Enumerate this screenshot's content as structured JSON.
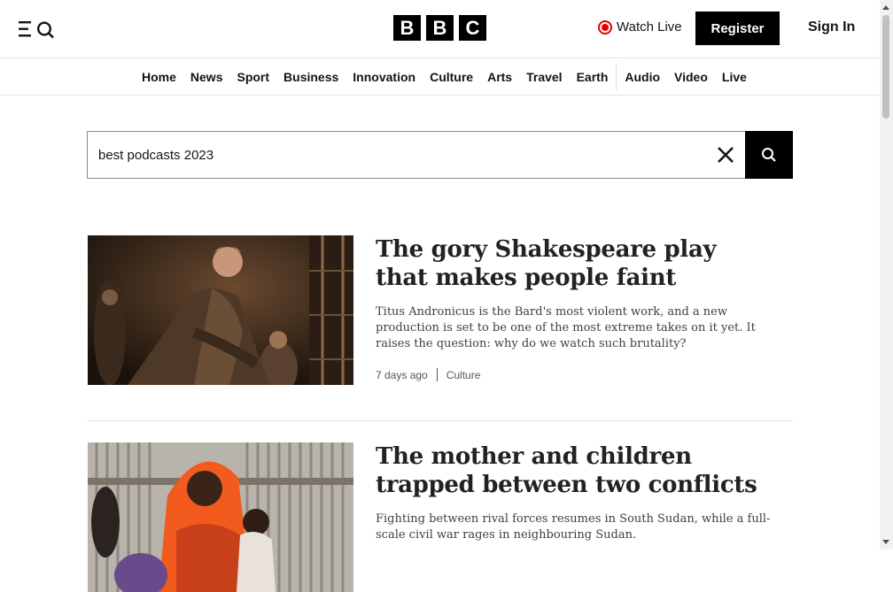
{
  "header": {
    "menu_icon": "menu-search-icon",
    "logo_letters": [
      "B",
      "B",
      "C"
    ],
    "watch_live": "Watch Live",
    "register": "Register",
    "sign_in": "Sign In"
  },
  "nav": {
    "items": [
      "Home",
      "News",
      "Sport",
      "Business",
      "Innovation",
      "Culture",
      "Arts",
      "Travel",
      "Earth",
      "Audio",
      "Video",
      "Live"
    ]
  },
  "search": {
    "value": "best podcasts 2023",
    "clear_icon": "close-icon",
    "search_icon": "search-icon"
  },
  "results": [
    {
      "title": "The gory Shakespeare play that makes people faint",
      "summary": "Titus Andronicus is the Bard's most violent work, and a new production is set to be one of the most extreme takes on it yet. It raises the question: why do we watch such brutality?",
      "time": "7 days ago",
      "category": "Culture"
    },
    {
      "title": "The mother and children trapped between two conflicts",
      "summary": "Fighting between rival forces resumes in South Sudan, while a full-scale civil war rages in neighbouring Sudan."
    }
  ],
  "colors": {
    "live_red": "#e50000",
    "black": "#000000",
    "text": "#141414"
  }
}
